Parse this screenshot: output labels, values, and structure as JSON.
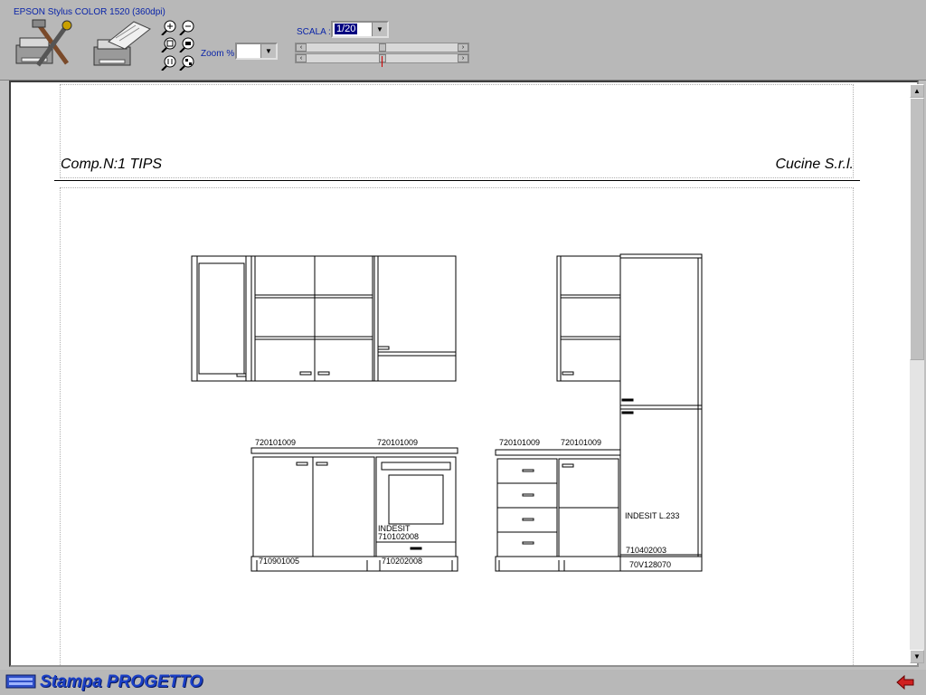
{
  "toolbar": {
    "printer_name": "EPSON Stylus COLOR 1520 (360dpi)",
    "zoom_label": "Zoom %",
    "zoom_value": "",
    "scala_label": "SCALA :",
    "scala_value": "1/20",
    "slider_left": "‹",
    "slider_right": "›"
  },
  "page": {
    "header_left": "Comp.N:1  TIPS",
    "header_right": "Cucine S.r.l."
  },
  "drawing": {
    "codes": {
      "top1": "720101009",
      "top2": "720101009",
      "top3": "720101009",
      "top4": "720101009",
      "oven_brand": "INDESIT",
      "oven_code": "710102008",
      "fridge_label": "INDESIT L.233",
      "fridge_code": "710402003",
      "base1": "710901005",
      "base2": "710202008",
      "base3": "70V128070"
    }
  },
  "status": {
    "title": "Stampa PROGETTO"
  },
  "colors": {
    "accent": "#1a3fc6",
    "selection": "#000080",
    "marker": "#d00000"
  },
  "icons": [
    "printer-setup-icon",
    "print-icon",
    "zoom-in-icon",
    "zoom-out-icon",
    "zoom-fit-icon",
    "zoom-actual-icon",
    "zoom-page-icon",
    "zoom-all-icon",
    "exit-icon"
  ]
}
